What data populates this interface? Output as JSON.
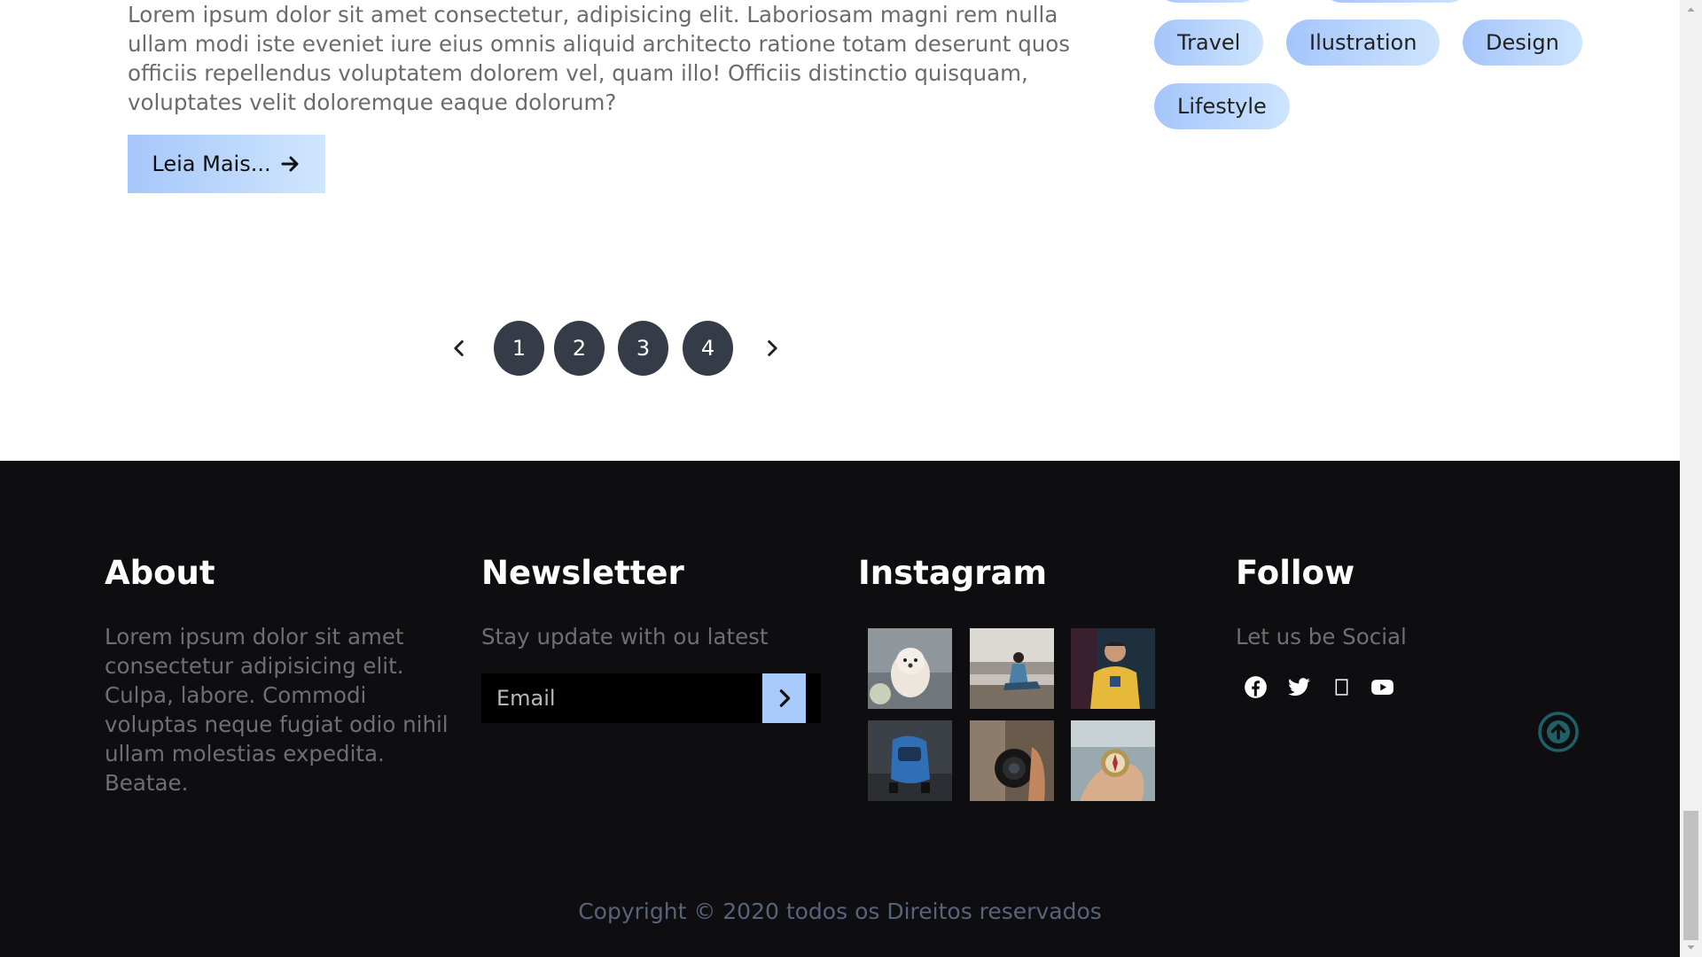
{
  "post": {
    "excerpt": "Lorem ipsum dolor sit amet consectetur, adipisicing elit. Laboriosam magni rem nulla ullam modi iste eveniet iure eius omnis aliquid architecto ratione totam deserunt quos officiis repellendus voluptatem dolorem vel, quam illo! Officiis distinctio quisquam, voluptates velit doloremque eaque dolorum?",
    "read_more_label": "Leia Mais...",
    "read_more_icon": "arrow-right-icon"
  },
  "tags": [
    "Travel",
    "Ilustration",
    "Design",
    "Lifestyle"
  ],
  "pagination": {
    "prev_icon": "chevron-left-icon",
    "next_icon": "chevron-right-icon",
    "pages": [
      "1",
      "2",
      "3",
      "4"
    ]
  },
  "footer": {
    "about": {
      "heading": "About",
      "text": "Lorem ipsum dolor sit amet consectetur adipisicing elit. Culpa, labore. Commodi voluptas neque fugiat odio nihil ullam molestias expedita. Beatae."
    },
    "newsletter": {
      "heading": "Newsletter",
      "text": "Stay update with ou latest",
      "email_placeholder": "Email",
      "submit_icon": "chevron-right-icon"
    },
    "instagram": {
      "heading": "Instagram",
      "photos": [
        "puppy-photo",
        "woman-sitting-photo",
        "man-yellow-sweater-photo",
        "blue-car-photo",
        "camera-photo",
        "compass-photo"
      ]
    },
    "follow": {
      "heading": "Follow",
      "text": "Let us be Social",
      "icons": [
        "facebook-icon",
        "twitter-icon",
        "instagram-icon",
        "youtube-icon"
      ]
    },
    "copyright": "Copyright © 2020 todos os Direitos reservados"
  },
  "colors": {
    "accent_gradient_start": "#a5c5fb",
    "accent_gradient_end": "#cde5fd",
    "footer_bg": "#0e0e10",
    "page_button": "#353c47",
    "back_to_top": "#1f5f66"
  }
}
